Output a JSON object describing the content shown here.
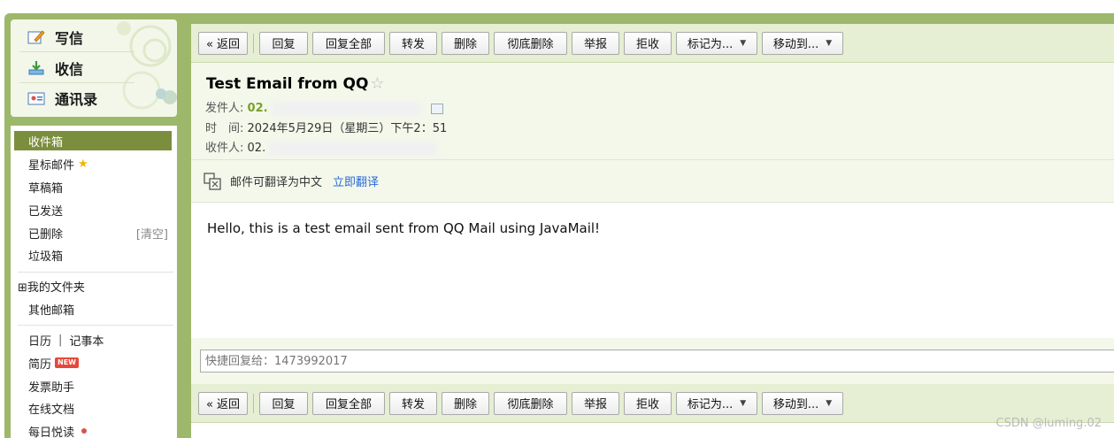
{
  "sidebar": {
    "actions": {
      "compose": "写信",
      "inbox": "收信",
      "contacts": "通讯录"
    },
    "folders": [
      {
        "label": "收件箱"
      },
      {
        "label": "星标邮件"
      },
      {
        "label": "草稿箱"
      },
      {
        "label": "已发送"
      },
      {
        "label": "已删除",
        "extra": "[清空]"
      },
      {
        "label": "垃圾箱"
      }
    ],
    "my_folders": "⊞我的文件夹",
    "other_mailboxes": "其他邮箱",
    "tools": {
      "calendar": "日历",
      "divider": "|",
      "notes": "记事本",
      "resume": "简历",
      "new_badge": "NEW",
      "invoice": "发票助手",
      "docs": "在线文档",
      "daily": "每日悦读"
    }
  },
  "toolbar": {
    "back": "« 返回",
    "reply": "回复",
    "reply_all": "回复全部",
    "forward": "转发",
    "delete": "删除",
    "delete_permanently": "彻底删除",
    "report": "举报",
    "reject": "拒收",
    "mark_as": "标记为...",
    "move_to": "移动到..."
  },
  "email": {
    "subject": "Test Email from QQ",
    "sender_label": "发件人:",
    "sender_value": "02.",
    "time_label": "时　间:",
    "time_value": "2024年5月29日（星期三）下午2：51",
    "recipient_label": "收件人:",
    "recipient_value": "02.",
    "body": "Hello, this is a test email sent from QQ Mail using JavaMail!"
  },
  "translate": {
    "notice": "邮件可翻译为中文",
    "action": "立即翻译"
  },
  "quick_reply": {
    "placeholder": "快捷回复给：1473992017"
  },
  "watermark": "CSDN @luming.02",
  "colors": {
    "frame_green": "#9db86a",
    "active_folder": "#7b8e3d",
    "toolbar_bg": "#e6eed3",
    "link_blue": "#2a6ad6"
  }
}
